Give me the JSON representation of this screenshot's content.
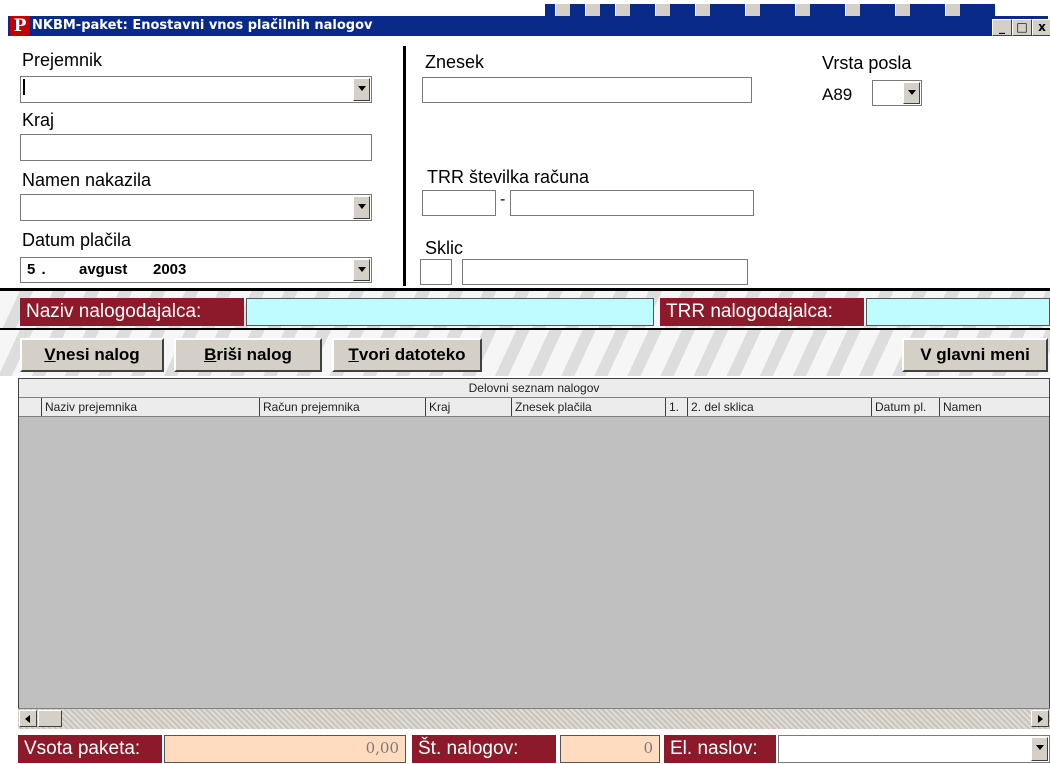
{
  "window": {
    "title": "NKBM-paket: Enostavni vnos plačilnih nalogov",
    "app_icon_letter": "P",
    "controls": {
      "minimize": "_",
      "maximize": "□",
      "close": "x"
    }
  },
  "form": {
    "prejemnik": {
      "label": "Prejemnik",
      "value": ""
    },
    "kraj": {
      "label": "Kraj",
      "value": ""
    },
    "namen": {
      "label": "Namen nakazila",
      "value": ""
    },
    "datum": {
      "label": "Datum plačila",
      "day": "5 .",
      "month": "avgust",
      "year": "2003"
    },
    "znesek": {
      "label": "Znesek",
      "value": ""
    },
    "trr": {
      "label": "TRR številka računa",
      "part1": "",
      "dash": "-",
      "part2": ""
    },
    "sklic": {
      "label": "Sklic",
      "part1": "",
      "part2": ""
    },
    "vrsta_posla": {
      "label": "Vrsta posla",
      "prefix": "A89",
      "value": ""
    }
  },
  "payer": {
    "naziv_label": "Naziv nalogodajalca:",
    "naziv_value": "",
    "trr_label": "TRR nalogodajalca:",
    "trr_value": ""
  },
  "toolbar": {
    "vnesi": {
      "hotkey": "V",
      "rest": "nesi nalog"
    },
    "brisi": {
      "hotkey": "B",
      "rest": "riši nalog"
    },
    "tvori": {
      "hotkey": "T",
      "rest": "vori datoteko"
    },
    "glavni": {
      "before": "V ",
      "hotkey": "g",
      "rest": "lavni meni"
    }
  },
  "grid": {
    "caption": "Delovni seznam nalogov",
    "columns": [
      "Naziv prejemnika",
      "Račun prejemnika",
      "Kraj",
      "Znesek plačila",
      "1.",
      "2. del sklica",
      "Datum pl.",
      "Namen"
    ],
    "rows": []
  },
  "footer": {
    "vsota_label": "Vsota paketa:",
    "vsota_value": "0,00",
    "st_label": "Št. nalogov:",
    "st_value": "0",
    "email_label": "El. naslov:",
    "email_value": ""
  },
  "colors": {
    "title_bar": "#0a2a8a",
    "label_bg": "#8c1a2a",
    "payer_field": "#bffcff",
    "footer_field": "#ffdcc0"
  }
}
